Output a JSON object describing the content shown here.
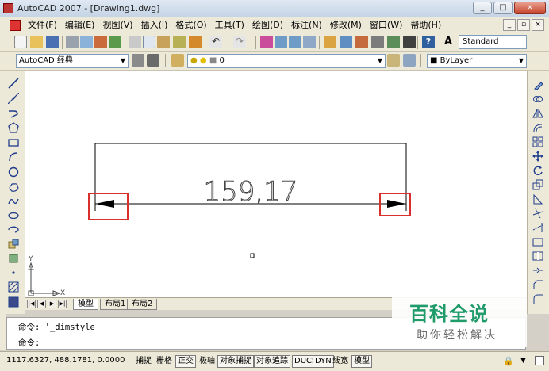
{
  "window": {
    "title": "AutoCAD 2007 - [Drawing1.dwg]",
    "buttons": [
      "_",
      "□",
      "×"
    ]
  },
  "menu": {
    "items": [
      "文件(F)",
      "编辑(E)",
      "视图(V)",
      "插入(I)",
      "格式(O)",
      "工具(T)",
      "绘图(D)",
      "标注(N)",
      "修改(M)",
      "窗口(W)",
      "帮助(H)"
    ],
    "mdi_buttons": [
      "_",
      "▫",
      "×"
    ]
  },
  "toolbar": {
    "text_style": "Standard",
    "workspace": "AutoCAD 经典",
    "layer": "0",
    "linetype": "ByLayer"
  },
  "drawing": {
    "dimension_text": "159,17",
    "ucs_y": "Y",
    "ucs_x": "X",
    "highlight_color": "#d9302b"
  },
  "layout_tabs": [
    "模型",
    "布局1",
    "布局2"
  ],
  "command": {
    "line1": "命令: '_dimstyle",
    "line2": "命令:"
  },
  "status": {
    "coordinates": "1117.6327, 488.1781, 0.0000",
    "toggles": [
      "捕捉",
      "栅格",
      "正交",
      "极轴",
      "对象捕捉",
      "对象追踪",
      "DUCS",
      "DYN",
      "线宽",
      "模型"
    ]
  },
  "watermark": {
    "title": "百科全说",
    "subtitle": "助你轻松解决"
  }
}
